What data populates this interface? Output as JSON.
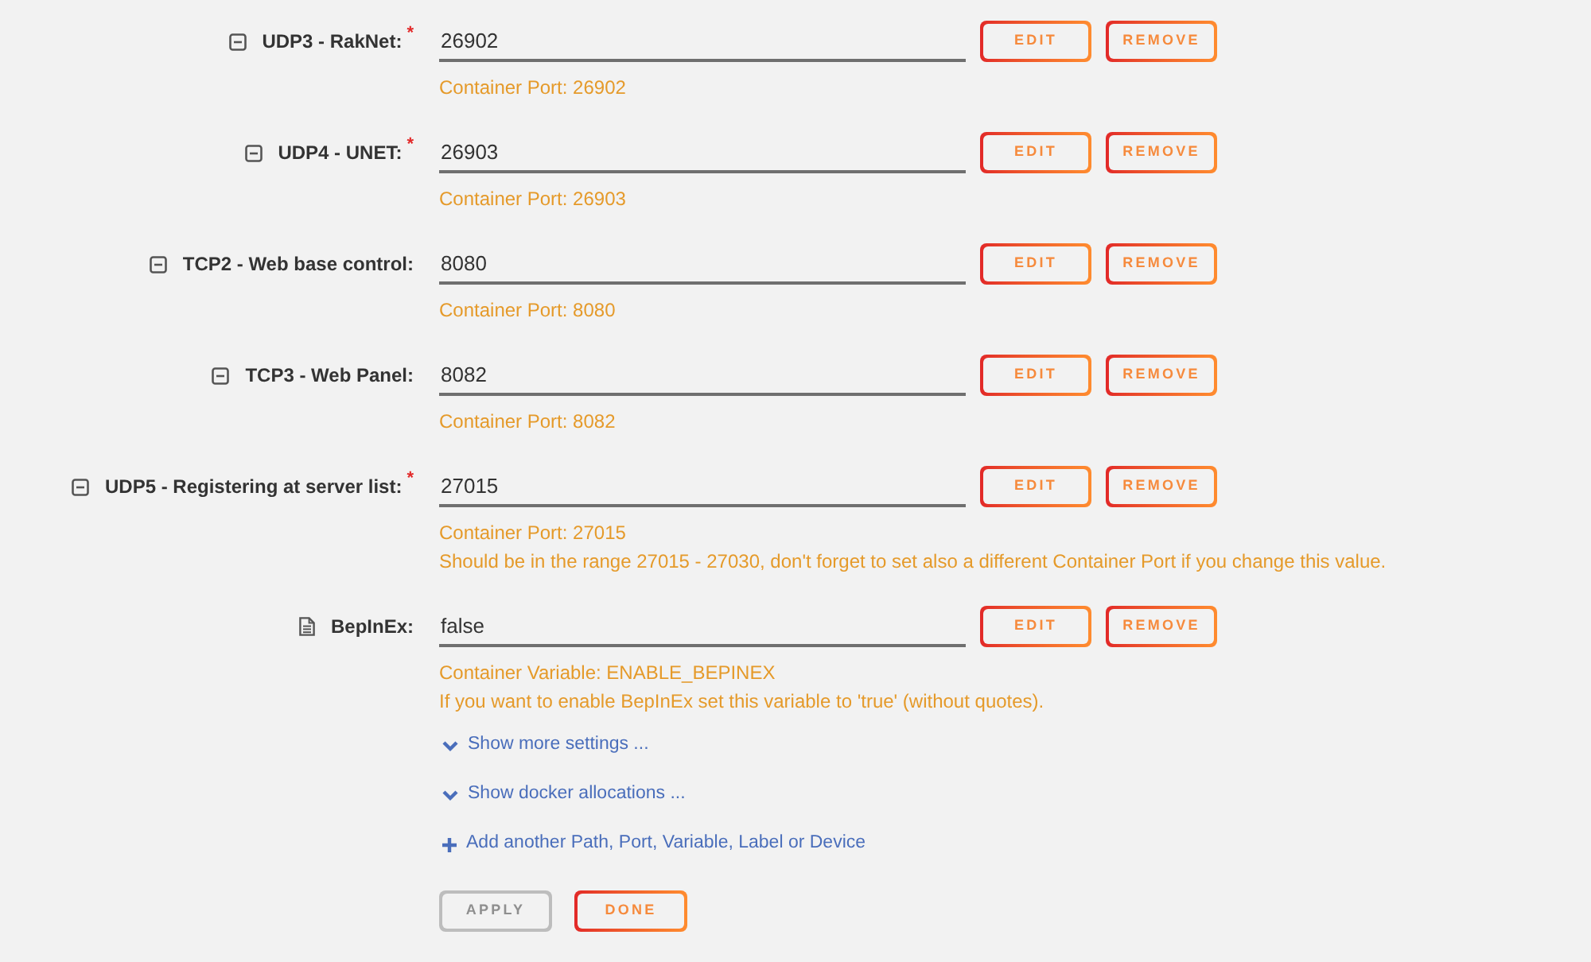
{
  "fields": [
    {
      "kind": "port",
      "label": "UDP3 - RakNet:",
      "required_mark": "*",
      "value": "26902",
      "buttons": [
        "EDIT",
        "REMOVE"
      ],
      "notes": [
        "Container Port: 26902"
      ]
    },
    {
      "kind": "port",
      "label": "UDP4 - UNET:",
      "required_mark": "*",
      "value": "26903",
      "buttons": [
        "EDIT",
        "REMOVE"
      ],
      "notes": [
        "Container Port: 26903"
      ]
    },
    {
      "kind": "port",
      "label": "TCP2 - Web base control:",
      "value": "8080",
      "buttons": [
        "EDIT",
        "REMOVE"
      ],
      "notes": [
        "Container Port: 8080"
      ]
    },
    {
      "kind": "port",
      "label": "TCP3 - Web Panel:",
      "value": "8082",
      "buttons": [
        "EDIT",
        "REMOVE"
      ],
      "notes": [
        "Container Port: 8082"
      ]
    },
    {
      "kind": "port",
      "label": "UDP5 - Registering at server list:",
      "required_mark": "*",
      "value": "27015",
      "buttons": [
        "EDIT",
        "REMOVE"
      ],
      "notes": [
        "Container Port: 27015",
        "Should be in the range 27015 - 27030, don't forget to set also a different Container Port if you change this value."
      ]
    },
    {
      "kind": "variable",
      "label": "BepInEx:",
      "value": "false",
      "buttons": [
        "EDIT",
        "REMOVE"
      ],
      "notes": [
        "Container Variable: ENABLE_BEPINEX",
        "If you want to enable BepInEx set this variable to 'true' (without quotes)."
      ]
    }
  ],
  "links": [
    {
      "kind": "expand",
      "label": "Show more settings ..."
    },
    {
      "kind": "expand",
      "label": "Show docker allocations ..."
    },
    {
      "kind": "add",
      "label": "Add another Path, Port, Variable, Label or Device"
    }
  ],
  "actions": [
    {
      "label": "APPLY",
      "disabled": true
    },
    {
      "label": "DONE",
      "disabled": false
    }
  ]
}
